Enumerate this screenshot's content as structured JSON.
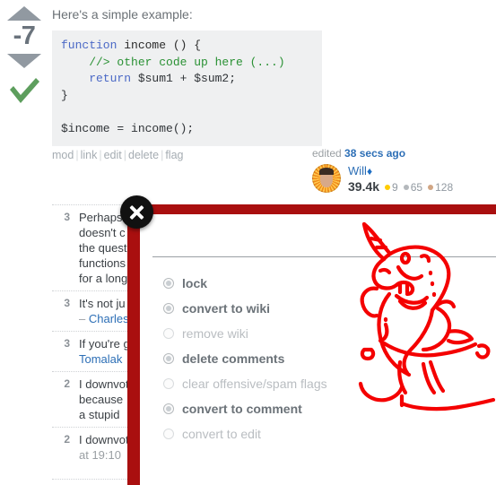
{
  "post": {
    "score": "-7",
    "accepted_icon": "check-icon",
    "upvote_icon": "up-arrow-icon",
    "downvote_icon": "down-arrow-icon",
    "intro": "Here's a simple example:",
    "code": {
      "line1_kw": "function",
      "line1_fn": " income () {",
      "line2": "    //> other code up here (...)",
      "line3_kw": "    return",
      "line3_rest": " $sum1 + $sum2;",
      "line4": "}",
      "line5": "",
      "line6": "$income = income();"
    },
    "menu": {
      "mod": "mod",
      "link": "link",
      "edit": "edit",
      "delete": "delete",
      "flag": "flag",
      "separator": "|"
    }
  },
  "user_card": {
    "edited_label": "edited",
    "edited_when": "38 secs ago",
    "name": "Will",
    "moderator_diamond": "♦",
    "reputation": "39.4k",
    "badges": {
      "gold": "9",
      "silver": "65",
      "bronze": "128"
    }
  },
  "comments": [
    {
      "score": "3",
      "text": "Perhaps",
      "suffix_lines": [
        "doesn't c",
        "the quest",
        "functions",
        "for a long"
      ]
    },
    {
      "score": "3",
      "text": "It's not ju",
      "author_dash": "– ",
      "author": "Charles"
    },
    {
      "score": "3",
      "text": "If you're g",
      "author": "Tomalak"
    },
    {
      "score": "2",
      "text": "I downvot",
      "suffix_lines": [
        "because",
        "a stupid "
      ]
    },
    {
      "score": "2",
      "text": "I downvot",
      "time": "at 19:10"
    }
  ],
  "dialog": {
    "title_bar_color": "#a90f0f",
    "close_icon": "close-icon",
    "options": [
      {
        "label": "lock",
        "enabled": true
      },
      {
        "label": "convert to wiki",
        "enabled": true
      },
      {
        "label": "remove wiki",
        "enabled": false
      },
      {
        "label": "delete comments",
        "enabled": true
      },
      {
        "label": "clear offensive/spam flags",
        "enabled": false
      },
      {
        "label": "convert to comment",
        "enabled": true
      },
      {
        "label": "convert to edit",
        "enabled": false
      }
    ],
    "decoration_icon": "narwhal-drawing",
    "decoration_color": "#f40000"
  }
}
